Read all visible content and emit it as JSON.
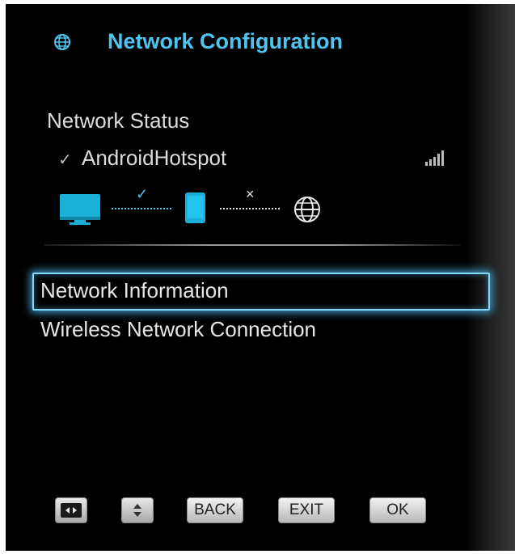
{
  "header": {
    "title": "Network Configuration",
    "icon": "globe-icon"
  },
  "status": {
    "label": "Network Status",
    "check_glyph": "✓",
    "ssid": "AndroidHotspot",
    "signal_icon": "signal-strength-icon",
    "diagram": {
      "tv_to_phone_state": "✓",
      "phone_to_internet_state": "×"
    }
  },
  "menu": {
    "items": [
      {
        "label": "Network Information",
        "selected": true
      },
      {
        "label": "Wireless Network Connection",
        "selected": false
      }
    ]
  },
  "footer": {
    "lr_key_icon": "left-right-arrows-icon",
    "ud_key_icon": "up-down-arrows-icon",
    "back_label": "BACK",
    "exit_label": "EXIT",
    "ok_label": "OK"
  },
  "colors": {
    "accent": "#4ec4f0",
    "screen_blue": "#1ab0d8",
    "text": "#dcdcdc"
  }
}
